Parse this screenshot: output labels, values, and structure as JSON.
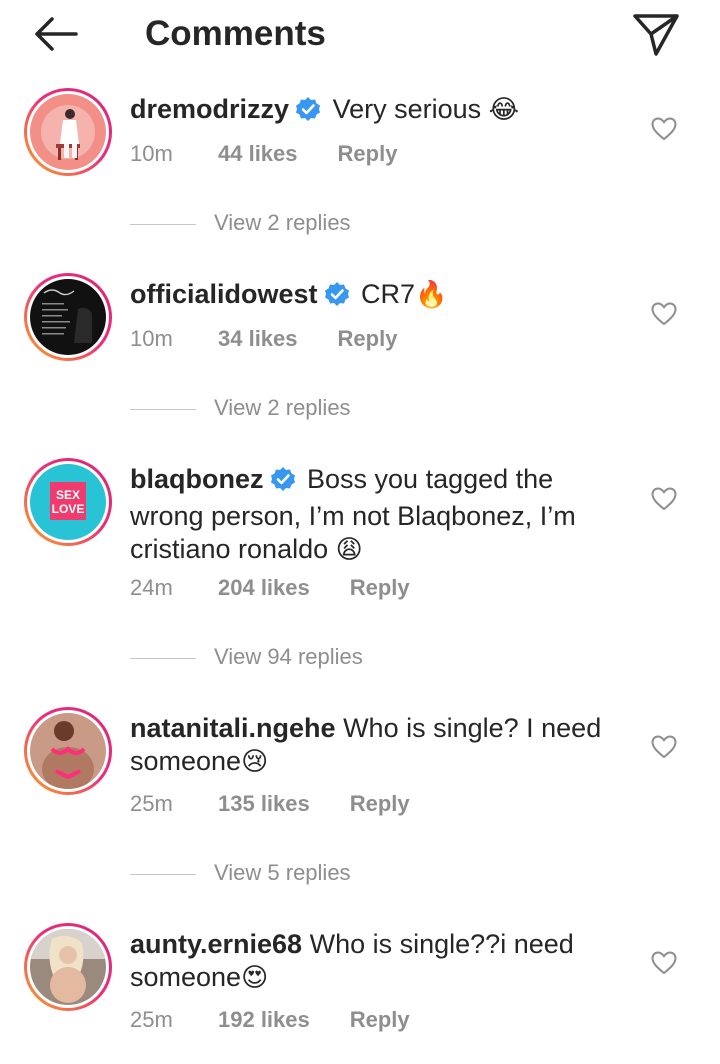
{
  "header": {
    "title": "Comments"
  },
  "comments": [
    {
      "username": "dremodrizzy",
      "verified": true,
      "text": "Very serious",
      "emoji": "😂",
      "time": "10m",
      "likes": "44 likes",
      "reply": "Reply",
      "view_replies": "View 2 replies"
    },
    {
      "username": "officialidowest",
      "verified": true,
      "text": "CR7",
      "emoji": "🔥",
      "time": "10m",
      "likes": "34 likes",
      "reply": "Reply",
      "view_replies": "View 2 replies"
    },
    {
      "username": "blaqbonez",
      "verified": true,
      "text": "Boss you tagged the wrong person, I’m not Blaqbonez, I’m cristiano ronaldo",
      "emoji": "😩",
      "time": "24m",
      "likes": "204 likes",
      "reply": "Reply",
      "view_replies": "View 94 replies"
    },
    {
      "username": "natanitali.ngehe",
      "verified": false,
      "text": "Who is single? I need someone",
      "emoji": "😢",
      "time": "25m",
      "likes": "135 likes",
      "reply": "Reply",
      "view_replies": "View 5 replies"
    },
    {
      "username": "aunty.ernie68",
      "verified": false,
      "text": "Who is single??i need someone",
      "emoji": "😍",
      "time": "25m",
      "likes": "192 likes",
      "reply": "Reply"
    }
  ],
  "avatars": {
    "blaqbonez_logo_line1": "SEX",
    "blaqbonez_logo_line2": "LOVE"
  },
  "colors": {
    "verified": "#3897f0",
    "muted": "#8e8e8e",
    "text": "#262626"
  }
}
